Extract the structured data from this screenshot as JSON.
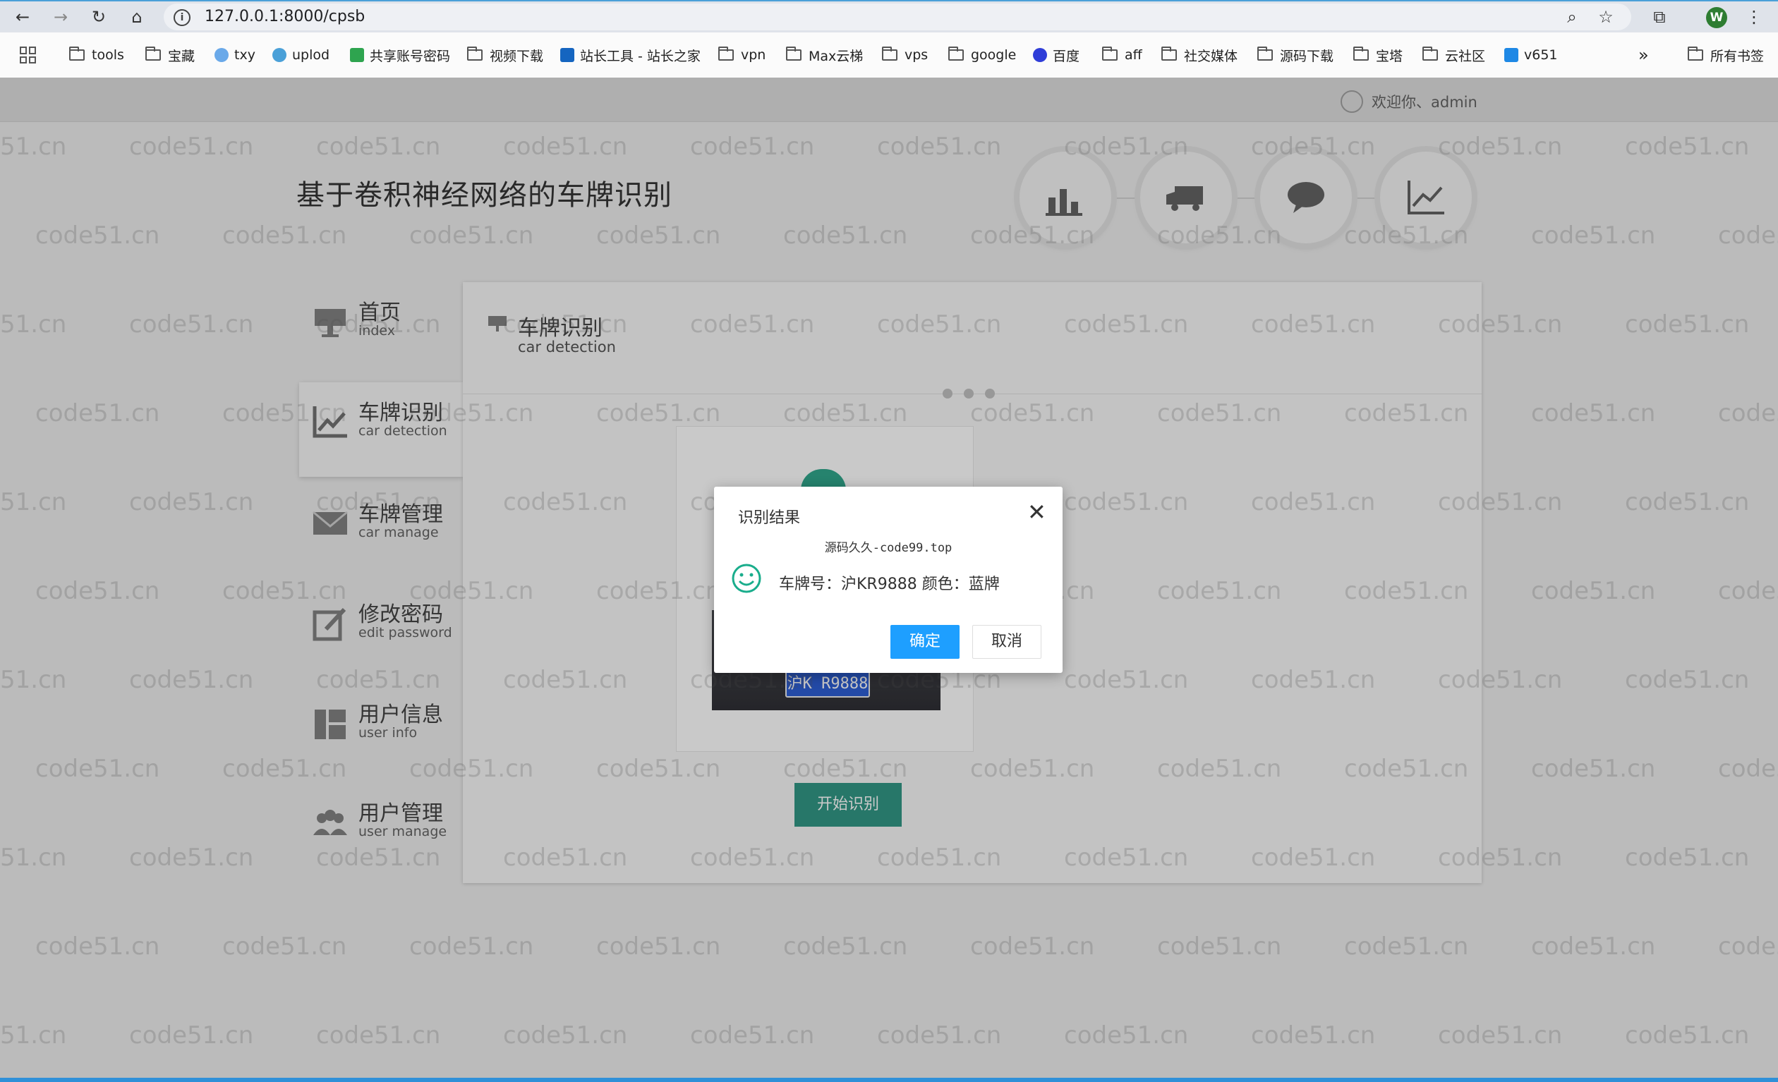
{
  "browser": {
    "url": "127.0.0.1:8000/cpsb",
    "profile_initial": "W",
    "bookmarks": [
      "tools",
      "宝藏",
      "txy",
      "uplod",
      "共享账号密码",
      "视频下载",
      "站长工具 - 站长之家",
      "vpn",
      "Max云梯",
      "vps",
      "google",
      "百度",
      "aff",
      "社交媒体",
      "源码下载",
      "宝塔",
      "云社区",
      "v651"
    ],
    "more_label": "»",
    "all_bookmarks": "所有书签"
  },
  "header": {
    "welcome": "欢迎你、admin",
    "site_title": "基于卷积神经网络的车牌识别"
  },
  "sidebar": {
    "items": [
      {
        "cn": "首页",
        "en": "index"
      },
      {
        "cn": "车牌识别",
        "en": "car detection"
      },
      {
        "cn": "车牌管理",
        "en": "car manage"
      },
      {
        "cn": "修改密码",
        "en": "edit password"
      },
      {
        "cn": "用户信息",
        "en": "user info"
      },
      {
        "cn": "用户管理",
        "en": "user manage"
      }
    ]
  },
  "content": {
    "title_cn": "车牌识别",
    "title_en": "car detection",
    "plate_image_text": "沪K R9888",
    "start_button": "开始识别"
  },
  "dialog": {
    "title": "识别结果",
    "close": "✕",
    "subtitle": "源码久久-code99.top",
    "message": "车牌号：沪KR9888 颜色：蓝牌",
    "ok": "确定",
    "cancel": "取消"
  },
  "watermark": "code51.cn",
  "colors": {
    "primary_button": "#1e9fff",
    "start_button": "#1f8e7a",
    "smile": "#1aad8c"
  }
}
